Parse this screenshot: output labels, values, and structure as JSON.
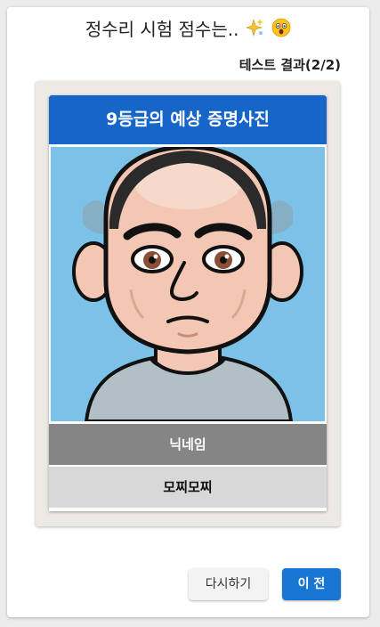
{
  "header": {
    "title": "정수리 시험 점수는..",
    "title_icons": [
      "sparkles-icon",
      "astonished-face-icon"
    ],
    "result_label": "테스트 결과(2/2)"
  },
  "result_card": {
    "title": "9등급의 예상 증명사진",
    "photo_icon": "cartoon-face-portrait",
    "nickname_label": "닉네임",
    "nickname_value": "모찌모찌"
  },
  "buttons": {
    "retry": "다시하기",
    "previous": "이 전"
  },
  "colors": {
    "accent": "#1976d2",
    "card_header": "#1665c8",
    "photo_background": "#7cc1e8"
  }
}
